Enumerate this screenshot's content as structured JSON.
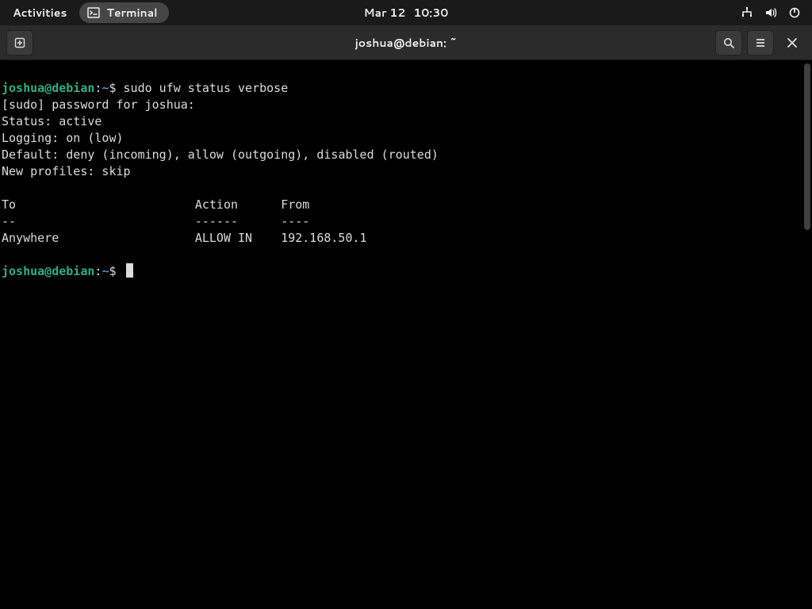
{
  "topbar": {
    "activities": "Activities",
    "app_name": "Terminal",
    "date": "Mar 12",
    "time": "10:30"
  },
  "headerbar": {
    "title": "joshua@debian: ~"
  },
  "prompt": {
    "user_host": "joshua@debian",
    "colon": ":",
    "path": "~",
    "dollar": "$"
  },
  "term": {
    "command": "sudo ufw status verbose",
    "sudo_prompt": "[sudo] password for joshua: ",
    "status_line": "Status: active",
    "logging_line": "Logging: on (low)",
    "default_line": "Default: deny (incoming), allow (outgoing), disabled (routed)",
    "profiles_line": "New profiles: skip",
    "header": {
      "to": "To",
      "action": "Action",
      "from": "From"
    },
    "header_sep": {
      "to": "--",
      "action": "------",
      "from": "----"
    },
    "rules": [
      {
        "to": "Anywhere",
        "action": "ALLOW IN",
        "from": "192.168.50.1"
      }
    ]
  }
}
